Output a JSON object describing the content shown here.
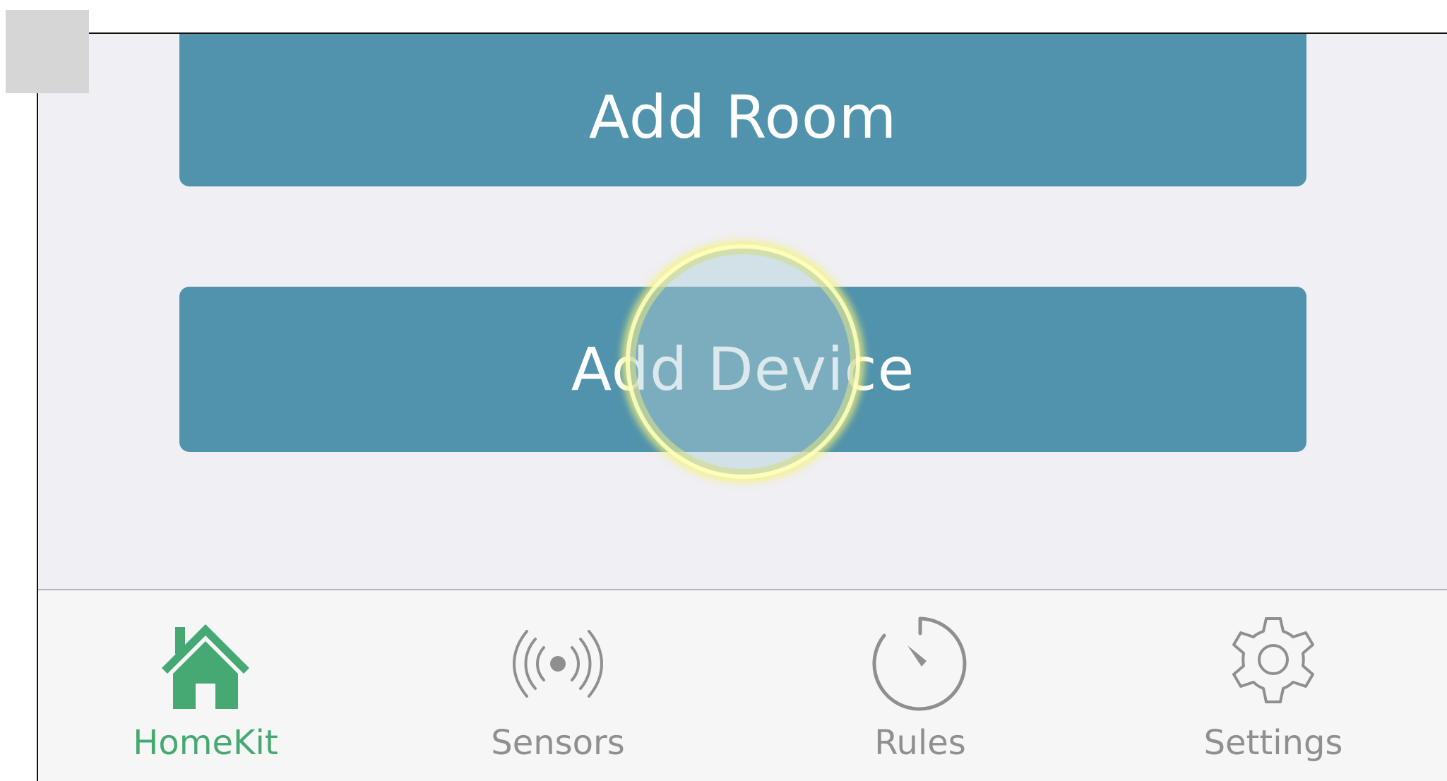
{
  "main": {
    "add_room_label": "Add Room",
    "add_device_label": "Add Device"
  },
  "tabbar": {
    "items": [
      {
        "label": "HomeKit",
        "icon": "house-icon",
        "active": true
      },
      {
        "label": "Sensors",
        "icon": "sensor-signal-icon",
        "active": false
      },
      {
        "label": "Rules",
        "icon": "timer-dial-icon",
        "active": false
      },
      {
        "label": "Settings",
        "icon": "gear-icon",
        "active": false
      }
    ]
  },
  "colors": {
    "button": "#5193ac",
    "active_tab": "#46a872",
    "inactive_tab": "#8f8f8f",
    "background": "#efeff4",
    "touch_highlight": "#f6f17b"
  }
}
